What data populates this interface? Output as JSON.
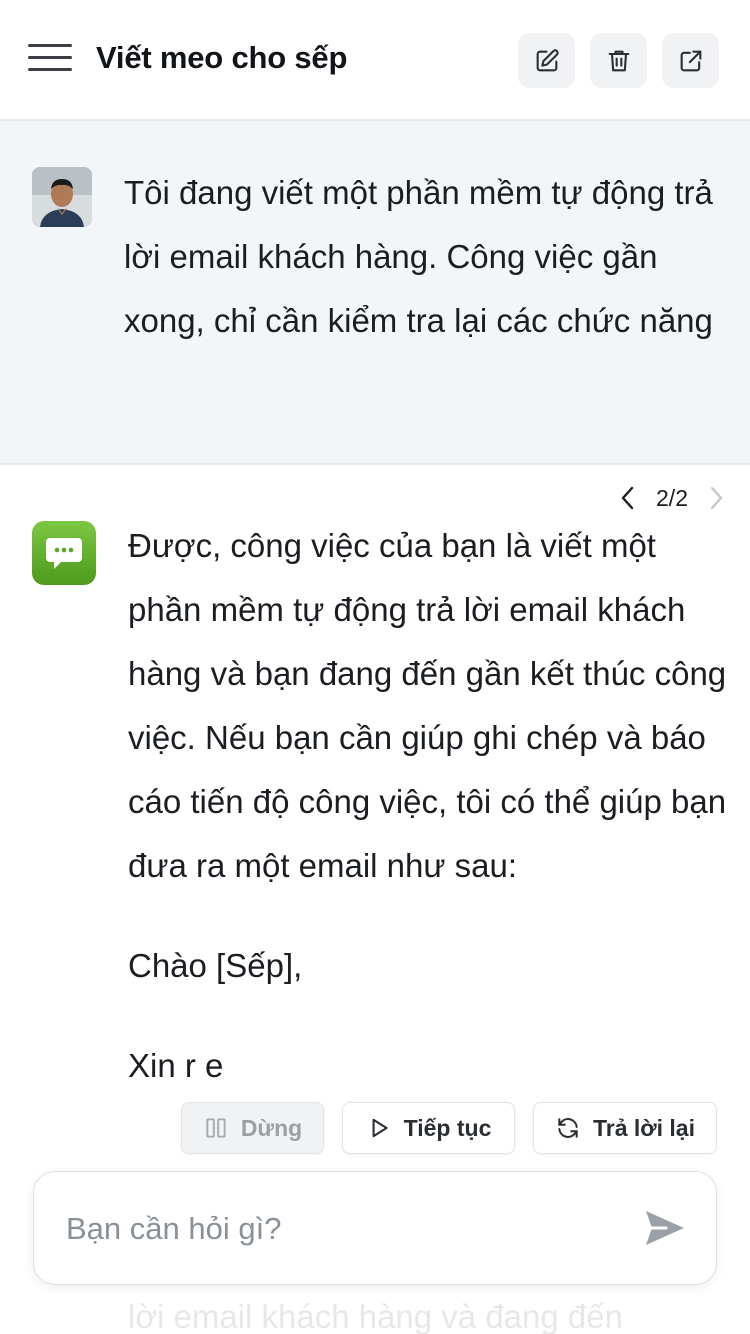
{
  "header": {
    "title": "Viết meo cho sếp",
    "buttons": [
      {
        "icon": "edit-icon"
      },
      {
        "icon": "trash-icon"
      },
      {
        "icon": "share-icon"
      }
    ]
  },
  "user_message": {
    "text": "Tôi đang viết một phần mềm tự động trả lời email khách hàng. Công việc gần xong, chỉ cần kiểm tra lại các chức năng"
  },
  "pager": {
    "current": "2/2"
  },
  "bot_message": {
    "paragraphs": [
      "Được, công việc của bạn là viết một phần mềm tự động trả lời email khách hàng và bạn đang đến gần kết thúc công việc. Nếu bạn cần giúp ghi chép và báo cáo tiến độ công việc, tôi có thể giúp bạn đưa ra một email như sau:",
      "Chào [Sếp],"
    ],
    "partial_line": "Xin          r         e"
  },
  "actions": {
    "stop_label": "Dừng",
    "continue_label": "Tiếp tục",
    "regenerate_label": "Trả lời lại"
  },
  "composer": {
    "placeholder": "Bạn cần hỏi gì?"
  },
  "ghost_text": "lời email khách hàng và đang đến",
  "colors": {
    "accent_green": "#5aa723",
    "user_bg": "#f3f6f9",
    "send_icon": "#9aa0a6"
  }
}
